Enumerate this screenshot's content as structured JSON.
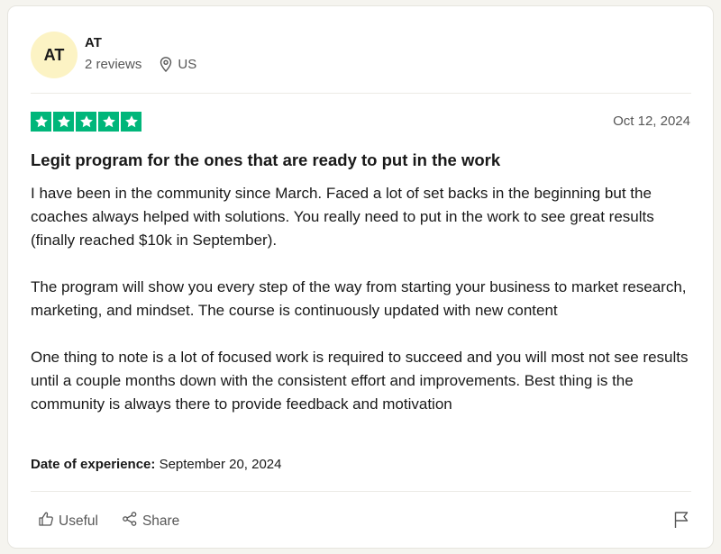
{
  "reviewer": {
    "initials": "AT",
    "name": "AT",
    "reviews_count": "2 reviews",
    "location": "US",
    "avatar_color": "#fcf3c4"
  },
  "rating": {
    "stars": 5,
    "max_stars": 5,
    "star_color": "#00b67a"
  },
  "review": {
    "date": "Oct 12, 2024",
    "title": "Legit program for the ones that are ready to put in the work",
    "paragraphs": [
      "I have been in the community since March. Faced a lot of set backs in the beginning but the coaches always helped with solutions. You really need to put in the work to see great results (finally reached $10k in September).",
      "The program will show you every step of the way from starting your business to market research, marketing, and mindset. The course is continuously updated with new content",
      "One thing to note is a lot of focused work is required to succeed and you will most not see results until a couple months down with the consistent effort and improvements. Best thing is the community is always there to provide feedback and motivation"
    ],
    "experience_label": "Date of experience:",
    "experience_date": "September 20, 2024"
  },
  "actions": {
    "useful_label": "Useful",
    "useful_icon": "thumbs-up-icon",
    "share_label": "Share",
    "share_icon": "share-icon",
    "report_icon": "flag-icon"
  }
}
